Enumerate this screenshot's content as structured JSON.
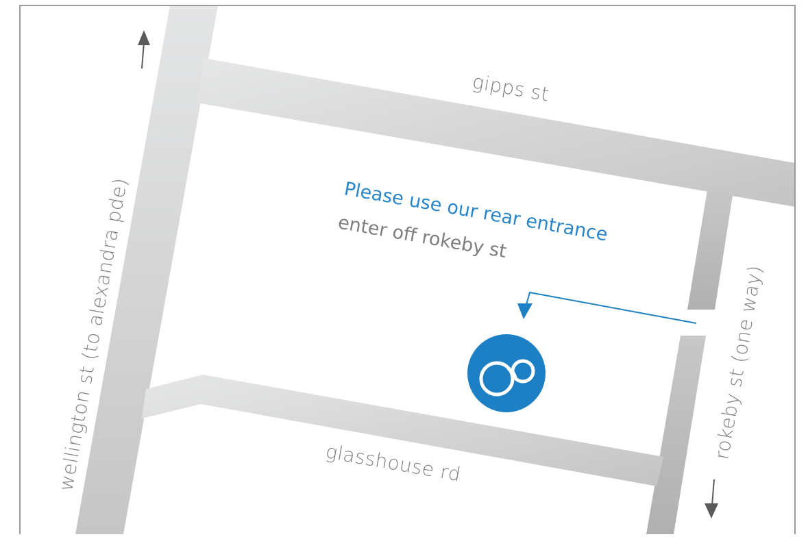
{
  "map": {
    "streets": {
      "gipps": "gipps st",
      "wellington": "wellington st  (to alexandra pde)",
      "rokeby": "rokeby st (one way)",
      "glasshouse": "glasshouse rd"
    },
    "notice": {
      "headline": "Please use our rear entrance",
      "detail": "enter off rokeby st"
    },
    "icons": {
      "location_marker": "location-pin-icon",
      "north_arrow": "arrow-up-icon",
      "south_arrow": "arrow-down-icon",
      "entrance_arrow": "arrow-bent-down-icon"
    },
    "colors": {
      "road": "#d2d2d2",
      "road_dark": "#bdbdbd",
      "accent": "#1e80c4",
      "label_gray": "#7f7f7f",
      "border": "#9a9a9a"
    }
  }
}
